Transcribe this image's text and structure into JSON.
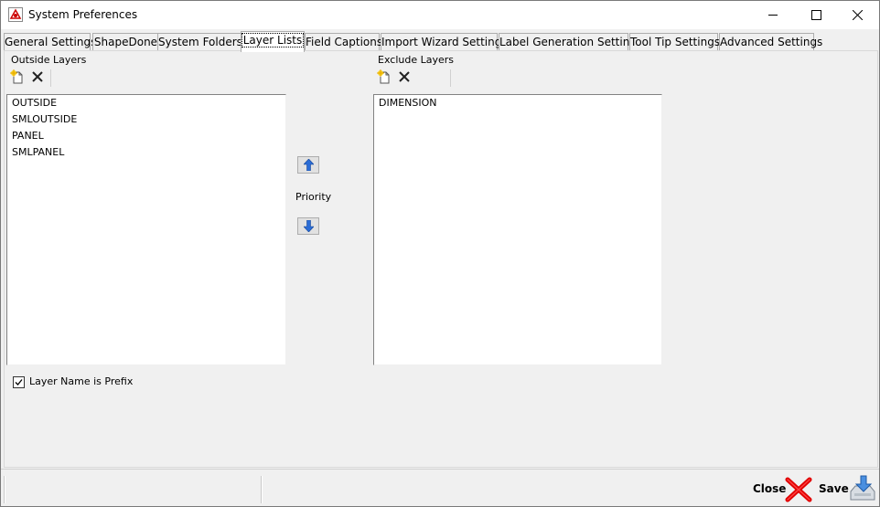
{
  "window": {
    "title": "System Preferences"
  },
  "tabs": [
    {
      "label": "General Settings"
    },
    {
      "label": "ShapeDone"
    },
    {
      "label": "System Folders"
    },
    {
      "label": "Layer Lists"
    },
    {
      "label": "Field Captions"
    },
    {
      "label": "Import Wizard Settings"
    },
    {
      "label": "Label Generation Settings"
    },
    {
      "label": "Tool Tip Settings"
    },
    {
      "label": "Advanced Settings"
    }
  ],
  "active_tab": "Layer Lists",
  "outside_layers": {
    "label": "Outside Layers",
    "items": [
      "OUTSIDE",
      "SMLOUTSIDE",
      "PANEL",
      "SMLPANEL"
    ]
  },
  "exclude_layers": {
    "label": "Exclude Layers",
    "items": [
      "DIMENSION"
    ]
  },
  "priority": {
    "label": "Priority"
  },
  "prefix_checkbox": {
    "label": "Layer Name is Prefix",
    "checked": true
  },
  "actions": {
    "close_label": "Close",
    "save_label": "Save"
  },
  "colors": {
    "close_red": "#e00000",
    "arrow_blue": "#2a6cd6"
  }
}
